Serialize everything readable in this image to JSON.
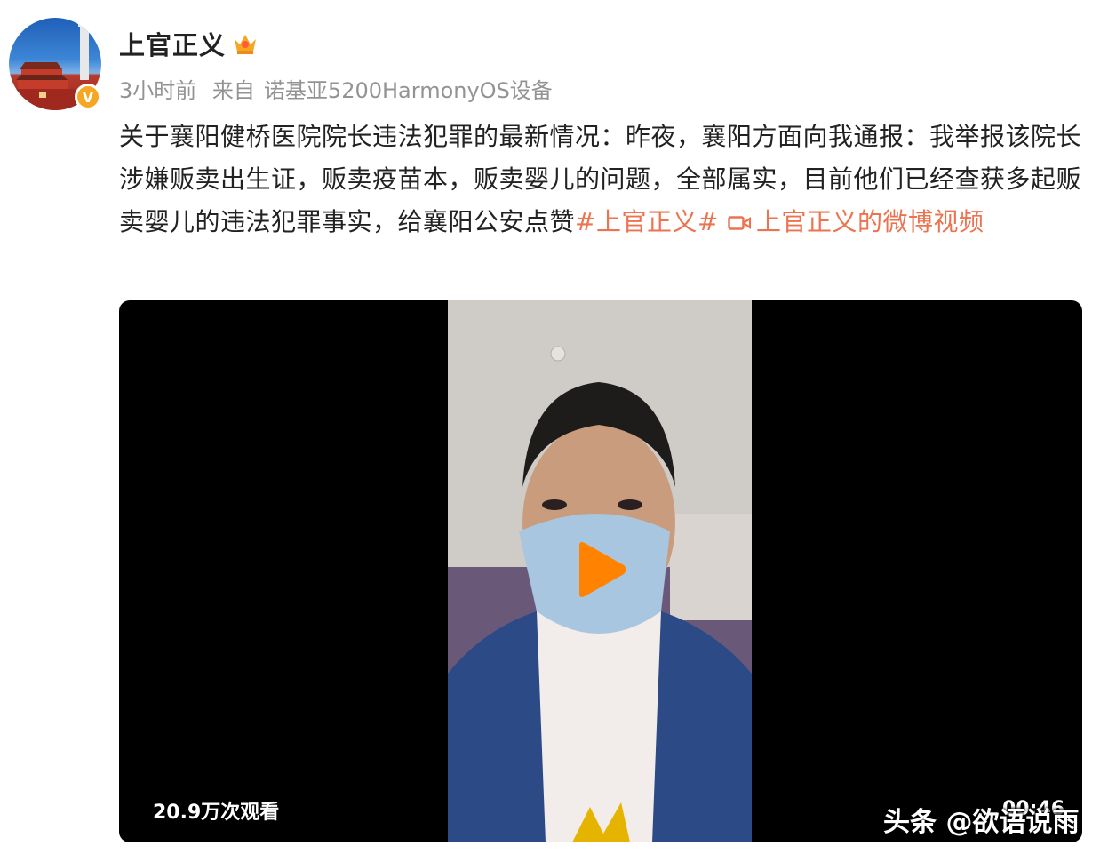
{
  "post": {
    "username": "上官正义",
    "time": "3小时前",
    "source_prefix": "来自",
    "source_device": "诺基亚5200HarmonyOS设备",
    "text_main": "关于襄阳健桥医院院长违法犯罪的最新情况：昨夜，襄阳方面向我通报：我举报该院长涉嫌贩卖出生证，贩卖疫苗本，贩卖婴儿的问题，全部属实，目前他们已经查获多起贩卖婴儿的违法犯罪事实，给襄阳公安点赞",
    "hashtag": "#上官正义#",
    "video_link": "上官正义的微博视频"
  },
  "video": {
    "views": "20.9万次观看",
    "duration": "00:46"
  },
  "watermark": "头条 @欲语说雨",
  "colors": {
    "link": "#eb7350",
    "verified": "#f5a623",
    "meta": "#939393"
  },
  "icons": {
    "verified": "verified-badge-icon",
    "crown": "crown-icon",
    "video": "video-icon",
    "play": "play-icon"
  }
}
